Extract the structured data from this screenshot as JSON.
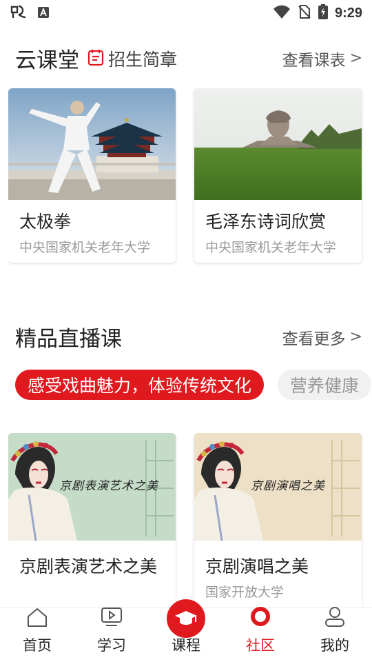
{
  "status_bar": {
    "time": "9:29",
    "icons": [
      "app-logo-icon",
      "a-notification-icon",
      "wifi-icon",
      "no-sim-icon",
      "battery-charging-icon"
    ]
  },
  "cloud_class": {
    "title": "云课堂",
    "brochure_label": "招生简章",
    "schedule_link": "查看课表",
    "cards": [
      {
        "title": "太极拳",
        "subtitle": "中央国家机关老年大学"
      },
      {
        "title": "毛泽东诗词欣赏",
        "subtitle": "中央国家机关老年大学"
      }
    ]
  },
  "live_courses": {
    "title": "精品直播课",
    "more_link": "查看更多",
    "tags": [
      {
        "label": "感受戏曲魅力，体验传统文化",
        "active": true
      },
      {
        "label": "营养健康",
        "active": false
      }
    ],
    "cards": [
      {
        "title": "京剧表演艺术之美",
        "subtitle": "",
        "banner_text": "京剧表演艺术之美"
      },
      {
        "title": "京剧演唱之美",
        "subtitle": "国家开放大学",
        "banner_text": "京剧演唱之美"
      }
    ]
  },
  "bottom_nav": {
    "items": [
      {
        "label": "首页",
        "icon": "home-icon"
      },
      {
        "label": "学习",
        "icon": "video-icon"
      },
      {
        "label": "课程",
        "icon": "graduation-cap-icon"
      },
      {
        "label": "社区",
        "icon": "community-icon",
        "active": true
      },
      {
        "label": "我的",
        "icon": "user-icon"
      }
    ]
  },
  "colors": {
    "accent": "#e0191e",
    "text": "#222222",
    "muted": "#9a9a9a"
  }
}
